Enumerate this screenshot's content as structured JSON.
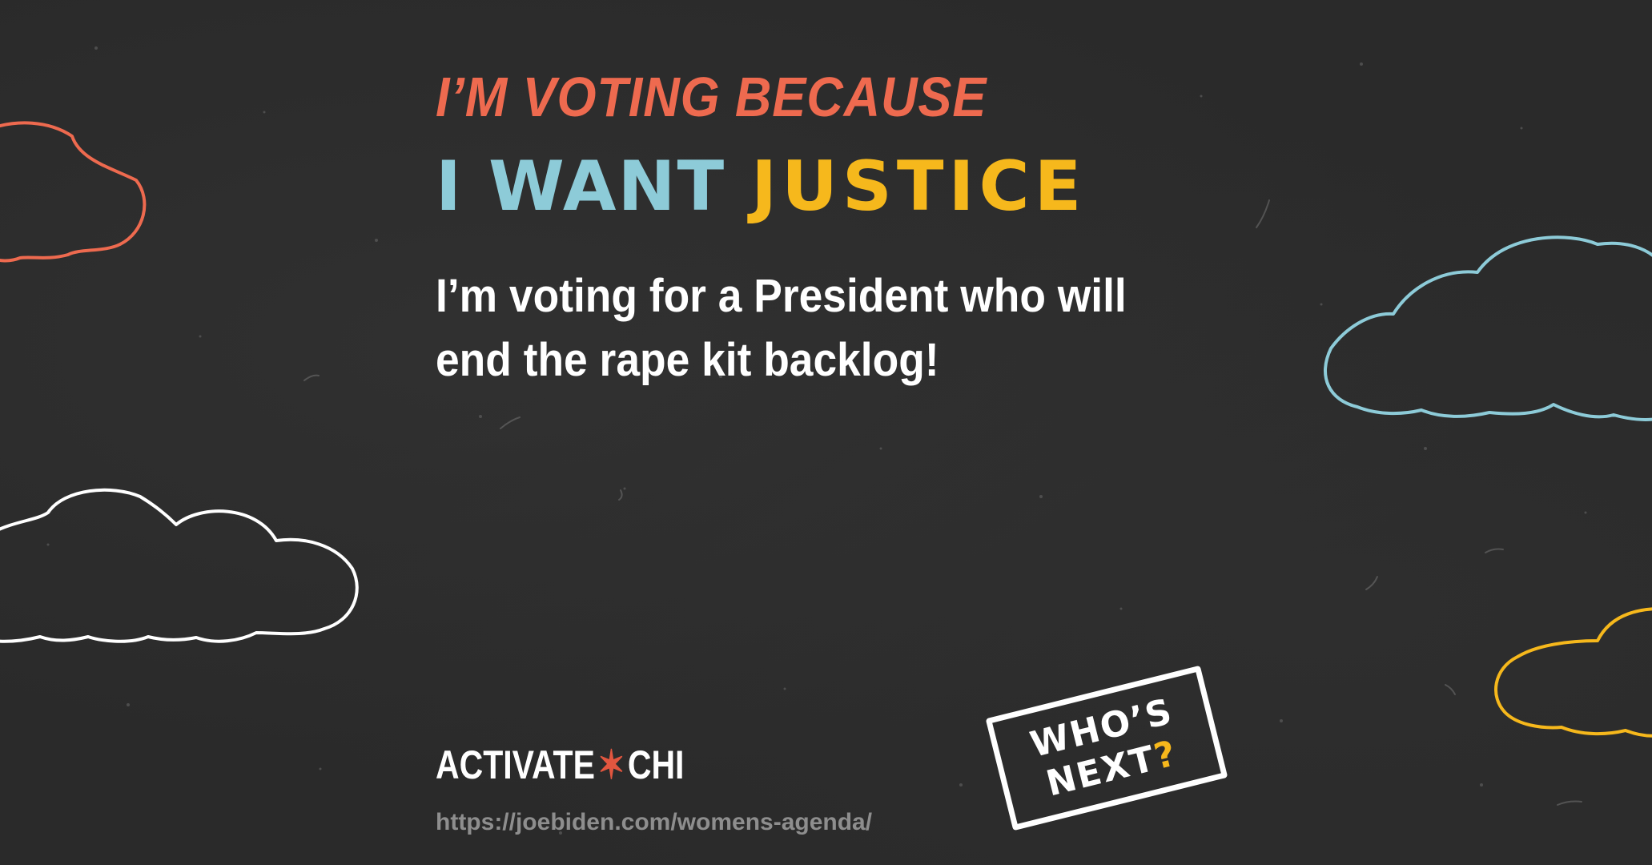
{
  "headline": {
    "line1": "I’M VOTING BECAUSE",
    "line2_part1": "I WANT",
    "line2_part2": "JUSTICE"
  },
  "message": {
    "line1": "I’m voting for a President who will",
    "line2": "end the rape kit backlog!"
  },
  "brand": {
    "left": "ACTIVATE",
    "star": "✶",
    "right": "CHI"
  },
  "url": "https://joebiden.com/womens-agenda/",
  "stamp": {
    "line1": "WHO’S",
    "line2_text": "NEXT",
    "line2_mark": "?"
  },
  "colors": {
    "background": "#2a2a2a",
    "coral": "#ee6a4f",
    "light_blue": "#8dcbd8",
    "yellow": "#f6b81c",
    "white": "#ffffff"
  },
  "decorations": [
    "coral-cloud-icon",
    "white-cloud-icon",
    "blue-cloud-icon",
    "yellow-cloud-icon"
  ]
}
